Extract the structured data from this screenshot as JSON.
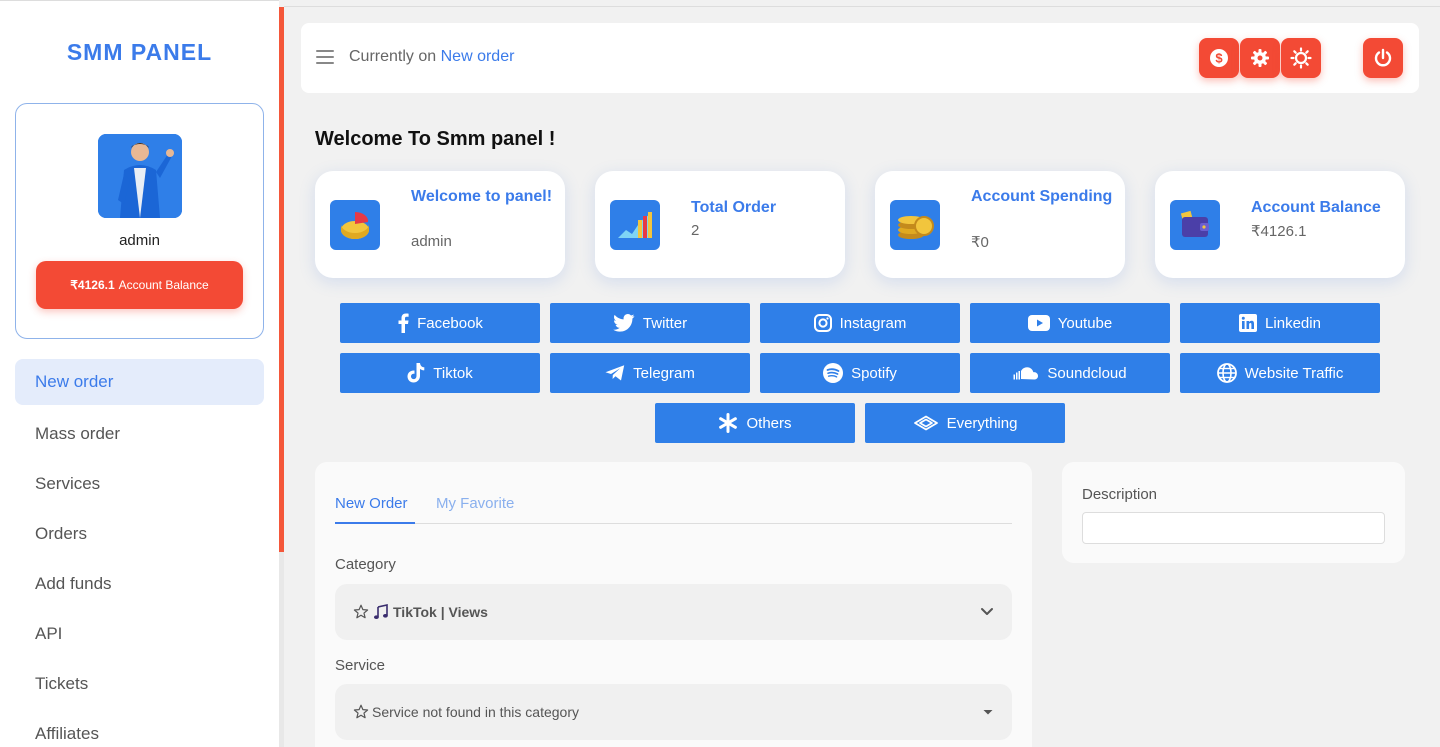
{
  "brand": "SMM PANEL",
  "profile": {
    "name": "admin",
    "balance_amount": "₹4126.1",
    "balance_label": "Account Balance"
  },
  "nav": [
    "New order",
    "Mass order",
    "Services",
    "Orders",
    "Add funds",
    "API",
    "Tickets",
    "Affiliates"
  ],
  "topbar": {
    "prefix": "Currently on",
    "page": "New order",
    "buttons": [
      "dollar-icon",
      "gear-icon",
      "sun-icon",
      "power-icon"
    ]
  },
  "welcome": "Welcome To  Smm panel !",
  "stats": [
    {
      "title": "Welcome to panel!",
      "value": "admin",
      "icon": "pie-chart-icon"
    },
    {
      "title": "Total Order",
      "value": "2",
      "icon": "bar-chart-icon"
    },
    {
      "title": "Account Spending",
      "value": "₹0",
      "icon": "coins-icon"
    },
    {
      "title": "Account Balance",
      "value": "₹4126.1",
      "icon": "wallet-icon"
    }
  ],
  "socials": [
    "Facebook",
    "Twitter",
    "Instagram",
    "Youtube",
    "Linkedin",
    "Tiktok",
    "Telegram",
    "Spotify",
    "Soundcloud",
    "Website Traffic",
    "Others",
    "Everything"
  ],
  "order": {
    "tabs": [
      "New Order",
      "My Favorite"
    ],
    "category_label": "Category",
    "category_value": "TikTok | Views",
    "service_label": "Service",
    "service_value": "Service not found in this category"
  },
  "description": {
    "label": "Description"
  },
  "colors": {
    "accent": "#3b7bea",
    "button_blue": "#2f7fe8",
    "danger": "#f34a35"
  }
}
